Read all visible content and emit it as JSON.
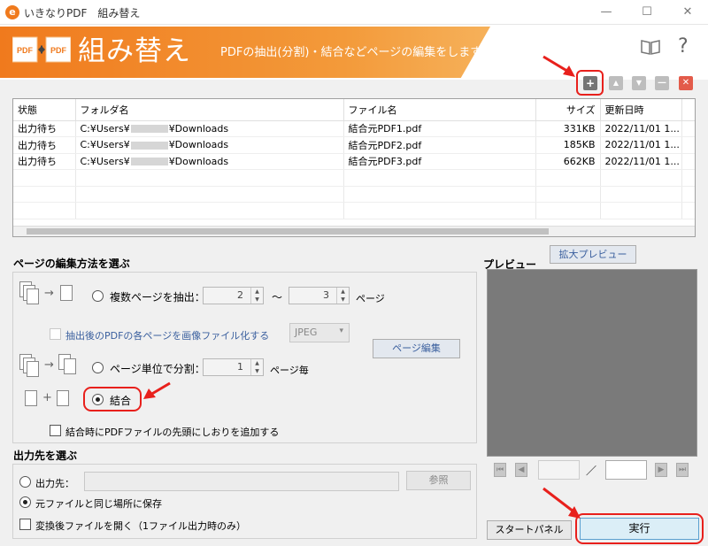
{
  "window": {
    "title": "いきなりPDF　組み替え",
    "app_icon": "e-logo-icon",
    "minimize": "—",
    "maximize": "☐",
    "close": "✕"
  },
  "header": {
    "logo_left": "PDF",
    "logo_right": "PDF",
    "title": "組み替え",
    "subtitle": "PDFの抽出(分割)・結合などページの編集をします",
    "help": "?"
  },
  "toolbar": {
    "add": "+",
    "up": "▲",
    "down": "▼",
    "remove": "—",
    "delete": "✕"
  },
  "table": {
    "columns": [
      "状態",
      "フォルダ名",
      "ファイル名",
      "サイズ",
      "更新日時"
    ],
    "rows": [
      {
        "status": "出力待ち",
        "folder_a": "C:¥Users¥",
        "folder_b": "¥Downloads",
        "file": "結合元PDF1.pdf",
        "size": "331KB",
        "date": "2022/11/01 1..."
      },
      {
        "status": "出力待ち",
        "folder_a": "C:¥Users¥",
        "folder_b": "¥Downloads",
        "file": "結合元PDF2.pdf",
        "size": "185KB",
        "date": "2022/11/01 1..."
      },
      {
        "status": "出力待ち",
        "folder_a": "C:¥Users¥",
        "folder_b": "¥Downloads",
        "file": "結合元PDF3.pdf",
        "size": "662KB",
        "date": "2022/11/01 1..."
      }
    ]
  },
  "edit": {
    "section_title": "ページの編集方法を選ぶ",
    "extract_label": "複数ページを抽出：",
    "extract_from": "2",
    "range_sep": "～",
    "extract_to": "3",
    "page_unit": "ページ",
    "image_export_label": "抽出後のPDFの各ページを画像ファイル化する",
    "image_format": "JPEG",
    "page_edit_button": "ページ編集",
    "split_label": "ページ単位で分割：",
    "split_value": "1",
    "split_unit": "ページ毎",
    "merge_label": "結合",
    "bookmark_label": "結合時にPDFファイルの先頭にしおりを追加する",
    "arrow": "→",
    "plus": "+",
    "selected_mode": "merge"
  },
  "preview": {
    "title": "プレビュー",
    "zoom_button": "拡大プレビュー",
    "page_sep": "／",
    "nav_first": "⏮",
    "nav_prev": "◀",
    "nav_next": "▶",
    "nav_last": "⏭"
  },
  "output": {
    "section_title": "出力先を選ぶ",
    "dest_label": "出力先：",
    "browse_button": "参照",
    "same_place_label": "元ファイルと同じ場所に保存",
    "open_after_label": "変換後ファイルを開く（1ファイル出力時のみ）",
    "selected": "same_place"
  },
  "footer": {
    "start_panel_button": "スタートパネル",
    "execute_button": "実行"
  },
  "colors": {
    "accent_orange": "#f07a1d",
    "annotation_red": "#e8201c",
    "execute_bg": "#dbeef7"
  }
}
